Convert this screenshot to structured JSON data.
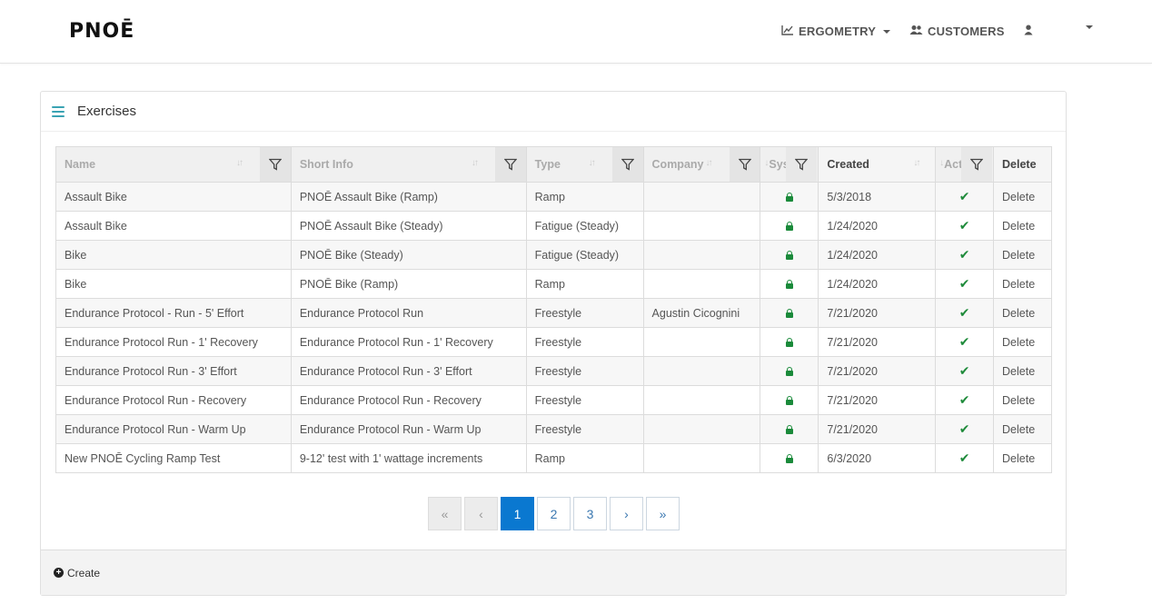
{
  "brand": {
    "logo_text": "PNOĒ"
  },
  "nav": {
    "ergometry": "ERGOMETRY",
    "customers": "CUSTOMERS"
  },
  "panel": {
    "title": "Exercises"
  },
  "table": {
    "headers": [
      "Name",
      "Short Info",
      "Type",
      "Company",
      "System",
      "Created",
      "Active",
      "Delete"
    ],
    "rows": [
      [
        "Assault Bike",
        "PNOĒ Assault Bike (Ramp)",
        "Ramp",
        "",
        "",
        "5/3/2018",
        "",
        "Delete"
      ],
      [
        "Assault Bike",
        "PNOĒ Assault Bike (Steady)",
        "Fatigue (Steady)",
        "",
        "",
        "1/24/2020",
        "",
        "Delete"
      ],
      [
        "Bike",
        "PNOĒ Bike (Steady)",
        "Fatigue (Steady)",
        "",
        "",
        "1/24/2020",
        "",
        "Delete"
      ],
      [
        "Bike",
        "PNOĒ Bike (Ramp)",
        "Ramp",
        "",
        "",
        "1/24/2020",
        "",
        "Delete"
      ],
      [
        "Endurance Protocol - Run - 5' Effort",
        "Endurance Protocol Run",
        "Freestyle",
        "Agustin Cicognini",
        "",
        "7/21/2020",
        "",
        "Delete"
      ],
      [
        "Endurance Protocol Run - 1' Recovery",
        "Endurance Protocol Run - 1' Recovery",
        "Freestyle",
        "",
        "",
        "7/21/2020",
        "",
        "Delete"
      ],
      [
        "Endurance Protocol Run - 3' Effort",
        "Endurance Protocol Run - 3' Effort",
        "Freestyle",
        "",
        "",
        "7/21/2020",
        "",
        "Delete"
      ],
      [
        "Endurance Protocol Run - Recovery",
        "Endurance Protocol Run - Recovery",
        "Freestyle",
        "",
        "",
        "7/21/2020",
        "",
        "Delete"
      ],
      [
        "Endurance Protocol Run - Warm Up",
        "Endurance Protocol Run - Warm Up",
        "Freestyle",
        "",
        "",
        "7/21/2020",
        "",
        "Delete"
      ],
      [
        "New PNOĒ Cycling Ramp Test",
        "9-12' test with 1' wattage increments",
        "Ramp",
        "",
        "",
        "6/3/2020",
        "",
        "Delete"
      ]
    ]
  },
  "pagination": {
    "first": "«",
    "prev": "‹",
    "pages": [
      "1",
      "2",
      "3"
    ],
    "current": "1",
    "next": "›",
    "last": "»"
  },
  "footer": {
    "create_label": "Create"
  },
  "colors": {
    "accent": "#0a78d0",
    "check": "#1f8b3b",
    "lock": "#1a8a3a",
    "menu_icon": "#3aa3b3"
  },
  "icons": [
    "chart-line-icon",
    "users-icon",
    "user-icon",
    "filter-icon",
    "lock-icon",
    "check-icon",
    "plus-circle-icon",
    "hamburger-icon",
    "sort-icon"
  ]
}
